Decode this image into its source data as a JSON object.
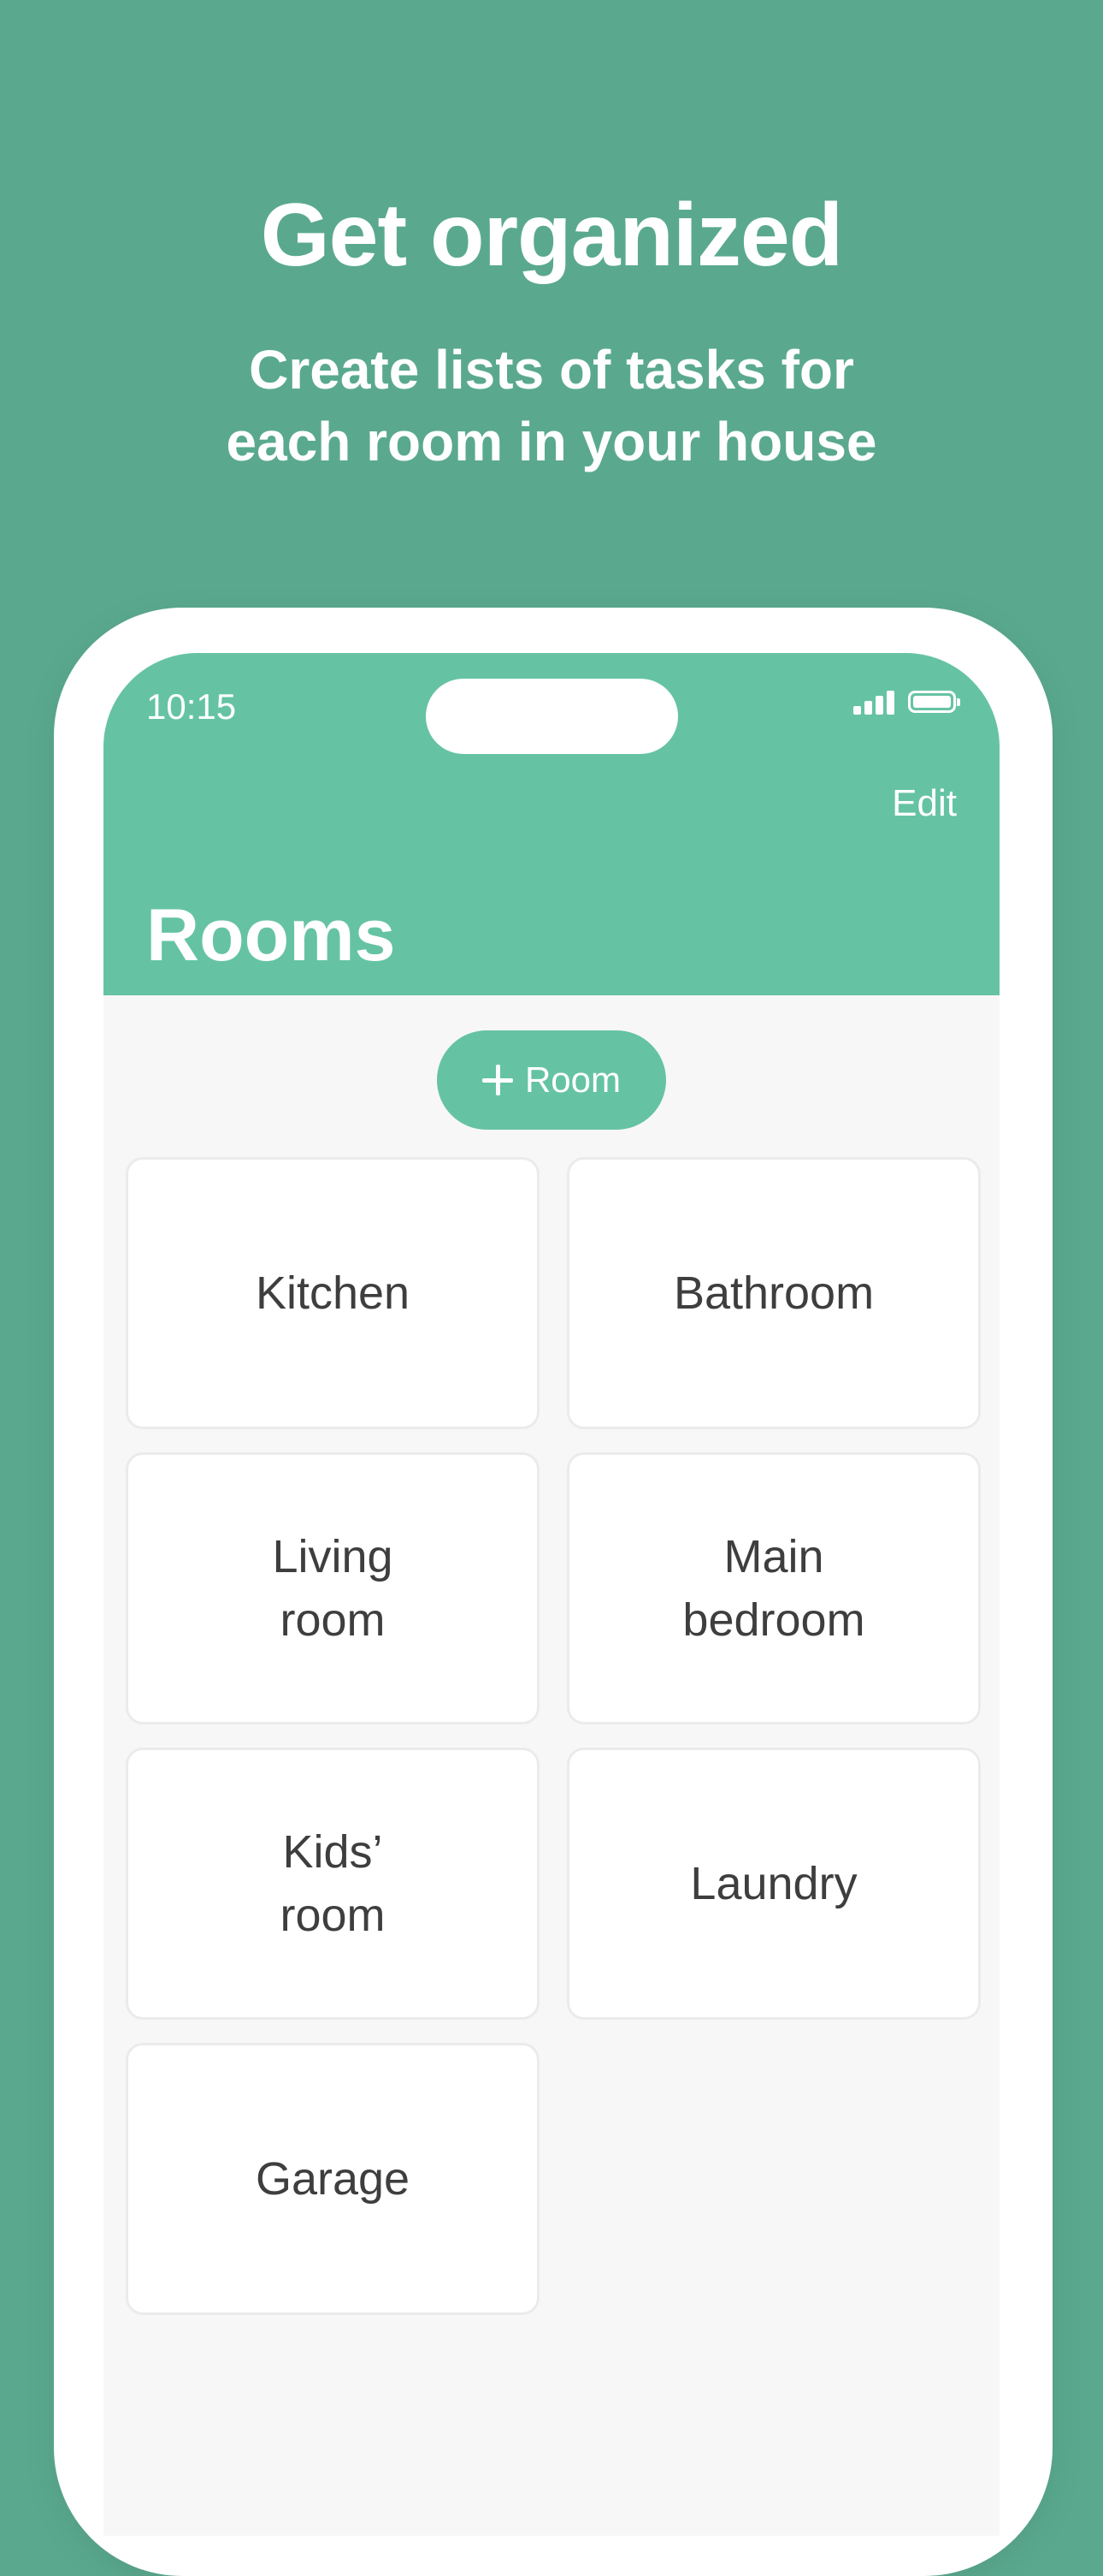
{
  "marketing": {
    "headline": "Get organized",
    "subhead": "Create lists of tasks for\neach room in your house"
  },
  "status_bar": {
    "time": "10:15",
    "signal_icon": "cellular-signal-icon",
    "battery_icon": "battery-full-icon"
  },
  "nav": {
    "edit_label": "Edit",
    "title": "Rooms"
  },
  "add_button": {
    "icon": "plus-icon",
    "label": "Room"
  },
  "rooms": [
    {
      "name": "Kitchen"
    },
    {
      "name": "Bathroom"
    },
    {
      "name": "Living\nroom"
    },
    {
      "name": "Main\nbedroom"
    },
    {
      "name": "Kids’\nroom"
    },
    {
      "name": "Laundry"
    },
    {
      "name": "Garage"
    }
  ],
  "colors": {
    "background": "#5aa98f",
    "accent": "#65c3a4",
    "card": "#ffffff",
    "card_text": "#3e3e3e",
    "list_background": "#f7f7f7"
  }
}
